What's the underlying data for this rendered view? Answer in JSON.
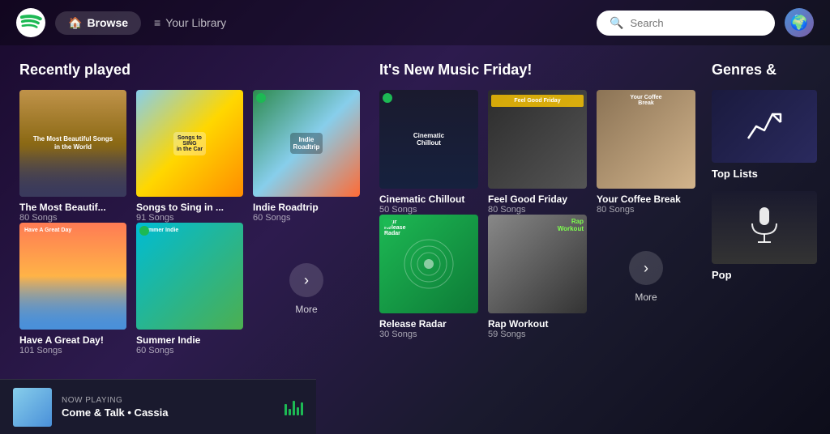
{
  "navbar": {
    "browse_label": "Browse",
    "library_label": "Your Library",
    "search_placeholder": "Search"
  },
  "recently_played": {
    "title": "Recently played",
    "cards": [
      {
        "id": "beautiful-songs",
        "title": "The Most Beautif...",
        "subtitle": "80 Songs",
        "img_class": "img-beautiful-songs",
        "img_text": "The Most Beautiful Songs\nin the World"
      },
      {
        "id": "songs-sing",
        "title": "Songs to Sing in ...",
        "subtitle": "91 Songs",
        "img_class": "img-songs-sing",
        "img_text": ""
      },
      {
        "id": "indie-roadtrip",
        "title": "Indie Roadtrip",
        "subtitle": "60 Songs",
        "img_class": "img-indie-roadtrip",
        "img_text": "Indie\nRoadtrip"
      },
      {
        "id": "great-day",
        "title": "Have A Great Day!",
        "subtitle": "101 Songs",
        "img_class": "img-great-day",
        "img_text": ""
      },
      {
        "id": "summer-indie",
        "title": "Summer Indie",
        "subtitle": "60 Songs",
        "img_class": "img-summer-indie",
        "img_text": ""
      }
    ],
    "more_label": "More"
  },
  "new_music": {
    "title": "It's New Music Friday!",
    "cards": [
      {
        "id": "cinematic",
        "title": "Cinematic Chillout",
        "subtitle": "50 Songs",
        "img_class": "img-cinematic",
        "img_text": "Cinematic\nChillout"
      },
      {
        "id": "feel-good",
        "title": "Feel Good Friday",
        "subtitle": "80 Songs",
        "img_class": "img-feel-good",
        "img_text": "Feel Good Friday"
      },
      {
        "id": "coffee-break",
        "title": "Your Coffee Break",
        "subtitle": "80 Songs",
        "img_class": "img-coffee",
        "img_text": "Your Coffee Break"
      },
      {
        "id": "release-radar",
        "title": "Release Radar",
        "subtitle": "30 Songs",
        "img_class": "img-release-radar",
        "img_text": ""
      },
      {
        "id": "rap-workout",
        "title": "Rap Workout",
        "subtitle": "59 Songs",
        "img_class": "img-rap-workout",
        "img_text": "Rap Workout"
      }
    ],
    "more_label": "More"
  },
  "genres": {
    "title": "Genres &",
    "cards": [
      {
        "id": "top-lists",
        "title": "Top Lists",
        "img_class": "img-top-lists"
      },
      {
        "id": "pop",
        "title": "Pop",
        "img_class": "img-pop"
      }
    ]
  },
  "now_playing": {
    "label": "NOW PLAYING",
    "title": "Come & Talk • Cassia"
  }
}
